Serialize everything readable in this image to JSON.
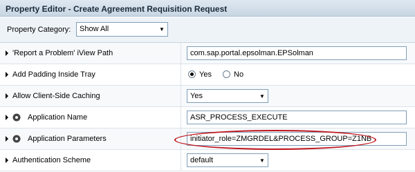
{
  "title": "Property Editor - Create Agreement Requisition Request",
  "category": {
    "label": "Property Category:",
    "selected": "Show All"
  },
  "rows": [
    {
      "label": "'Report a Problem' iView Path",
      "value": "com.sap.portal.epsolman.EPSolman"
    },
    {
      "label": "Add Padding Inside Tray",
      "options": [
        "Yes",
        "No"
      ],
      "selected": "Yes"
    },
    {
      "label": "Allow Client-Side Caching",
      "value": "Yes"
    },
    {
      "label": "Application Name",
      "value": "ASR_PROCESS_EXECUTE"
    },
    {
      "label": "Application Parameters",
      "value": "initiator_role=ZMGRDEL&PROCESS_GROUP=Z1NB"
    },
    {
      "label": "Authentication Scheme",
      "value": "default"
    }
  ],
  "colors": {
    "highlight": "#c0141b",
    "title_bg": "#c8d6e3"
  },
  "icons": {
    "expander": "triangle-right-icon",
    "property_icon": "gear-icon",
    "dropdown": "chevron-down-icon"
  }
}
